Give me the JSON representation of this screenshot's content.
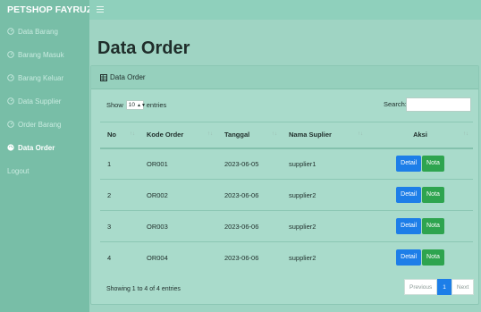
{
  "brand": "PETSHOP FAYRUZ",
  "sidebar": {
    "items": [
      {
        "label": "Data Barang"
      },
      {
        "label": "Barang Masuk"
      },
      {
        "label": "Barang Keluar"
      },
      {
        "label": "Data Supplier"
      },
      {
        "label": "Order Barang"
      },
      {
        "label": "Data Order"
      },
      {
        "label": "Logout"
      }
    ],
    "active_index": 5
  },
  "page": {
    "title": "Data Order"
  },
  "card": {
    "header": "Data Order"
  },
  "controls": {
    "show_label": "Show",
    "entries_value": "10",
    "entries_label": "entries",
    "search_label": "Search:",
    "search_value": ""
  },
  "table": {
    "headers": [
      "No",
      "Kode Order",
      "Tanggal",
      "Nama Suplier",
      "Aksi"
    ],
    "rows": [
      [
        "1",
        "OR001",
        "2023-06-05",
        "supplier1"
      ],
      [
        "2",
        "OR002",
        "2023-06-06",
        "supplier2"
      ],
      [
        "3",
        "OR003",
        "2023-06-06",
        "supplier2"
      ],
      [
        "4",
        "OR004",
        "2023-06-06",
        "supplier2"
      ]
    ],
    "action_labels": {
      "detail": "Detail",
      "nota": "Nota"
    }
  },
  "footer": {
    "info": "Showing 1 to 4 of 4 entries",
    "pagination": {
      "previous": "Previous",
      "current": "1",
      "next": "Next"
    }
  },
  "colors": {
    "sidebar_bg": "#78bea7",
    "content_bg": "#9fd4c3",
    "detail_button": "#1d7ee8",
    "nota_button": "#2ea44f"
  }
}
